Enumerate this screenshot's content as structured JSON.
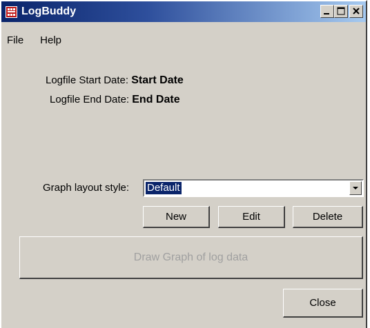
{
  "window": {
    "title": "LogBuddy"
  },
  "menu": {
    "items": [
      "File",
      "Help"
    ]
  },
  "logfile": {
    "start_label": "Logfile Start Date:",
    "start_value": "Start Date",
    "end_label": "Logfile End Date:",
    "end_value": "End Date"
  },
  "graph_layout": {
    "label": "Graph layout style:",
    "selected": "Default"
  },
  "buttons": {
    "new": "New",
    "edit": "Edit",
    "delete": "Delete",
    "draw_graph": "Draw Graph of log data",
    "close": "Close"
  },
  "icons": {
    "app": "logbuddy-app-icon",
    "minimize": "minimize-icon",
    "maximize": "maximize-icon",
    "close": "close-icon",
    "dropdown": "chevron-down-icon"
  },
  "colors": {
    "titlebar_start": "#0a246a",
    "titlebar_end": "#a6caf0",
    "window_bg": "#d4d0c8",
    "selection": "#0a246a"
  }
}
